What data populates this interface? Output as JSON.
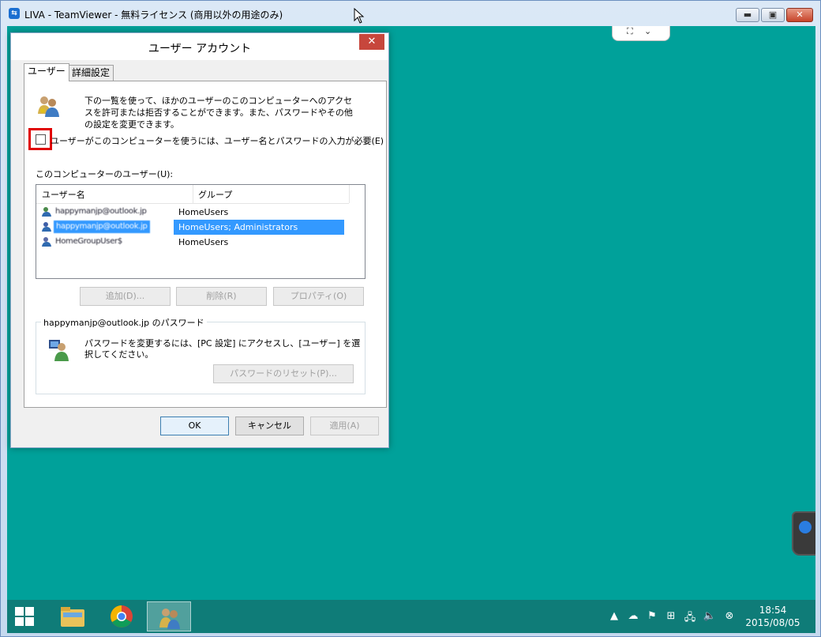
{
  "window": {
    "title": "LIVA - TeamViewer - 無料ライセンス (商用以外の用途のみ)",
    "controls": {
      "minimize": "▬",
      "maximize": "▣",
      "close": "✕"
    }
  },
  "teamviewer_panel": {
    "expand": "⛶",
    "collapse": "⌄"
  },
  "dialog": {
    "title": "ユーザー アカウント",
    "close": "✕",
    "tabs": [
      {
        "label": "ユーザー",
        "active": true
      },
      {
        "label": "詳細設定",
        "active": false
      }
    ],
    "description": "下の一覧を使って、ほかのユーザーのこのコンピューターへのアクセスを許可または拒否することができます。また、パスワードやその他の設定を変更できます。",
    "require_password": {
      "label": "ユーザーがこのコンピューターを使うには、ユーザー名とパスワードの入力が必要(E)",
      "checked": false
    },
    "users_list_title": "このコンピューターのユーザー(U):",
    "columns": [
      "ユーザー名",
      "グループ"
    ],
    "users": [
      {
        "name": "happymanjp@outlook.jp",
        "group": "HomeUsers",
        "selected": false
      },
      {
        "name": "happymanjp@outlook.jp",
        "group": "HomeUsers; Administrators",
        "selected": true
      },
      {
        "name": "HomeGroupUser$",
        "group": "HomeUsers",
        "selected": false
      }
    ],
    "buttons": {
      "add": "追加(D)...",
      "remove": "削除(R)",
      "properties": "プロパティ(O)"
    },
    "password_group": {
      "label": "happymanjp@outlook.jp のパスワード",
      "text": "パスワードを変更するには、[PC 設定] にアクセスし、[ユーザー] を選択してください。",
      "reset_button": "パスワードのリセット(P)..."
    },
    "footer": {
      "ok": "OK",
      "cancel": "キャンセル",
      "apply": "適用(A)"
    }
  },
  "taskbar": {
    "clock_time": "18:54",
    "clock_date": "2015/08/05",
    "tray_icons": [
      "▲",
      "☁",
      "⚑",
      "⊞",
      "🖧",
      "🔈",
      "⊗"
    ]
  },
  "colors": {
    "desktop": "#00a19a",
    "taskbar": "#0f7c78",
    "highlight": "#e00000",
    "selection": "#3399ff"
  }
}
